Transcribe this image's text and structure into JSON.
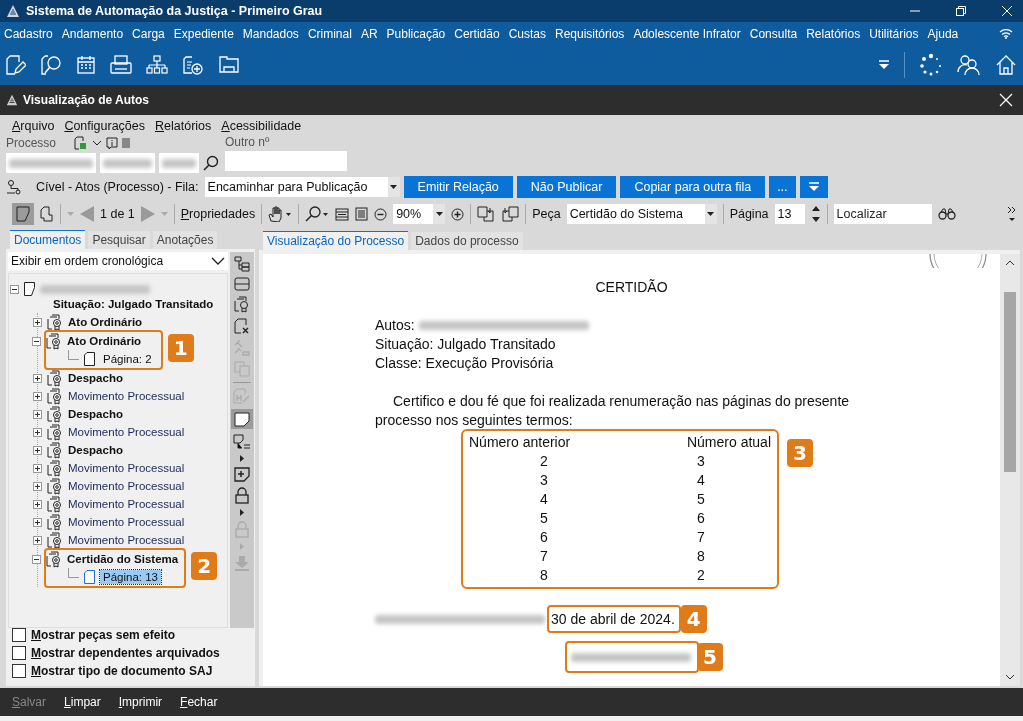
{
  "app_title": "Sistema de Automação da Justiça - Primeiro Grau",
  "main_menu": [
    "Cadastro",
    "Andamento",
    "Carga",
    "Expediente",
    "Mandados",
    "Criminal",
    "AR",
    "Publicação",
    "Certidão",
    "Custas",
    "Requisitórios",
    "Adolescente Infrator",
    "Consulta",
    "Relatórios",
    "Utilitários",
    "Ajuda"
  ],
  "window": {
    "title": "Visualização de Autos"
  },
  "menu": [
    "Arquivo",
    "Configurações",
    "Relatórios",
    "Acessibilidade"
  ],
  "process": {
    "label": "Processo",
    "other_label": "Outro nº"
  },
  "queue": {
    "label": "Cível - Atos (Processo) - Fila:",
    "value": "Encaminhar para Publicação"
  },
  "actions": [
    "Emitir Relação",
    "Não Publicar",
    "Copiar para outra fila",
    "..."
  ],
  "toolbar": {
    "pager": "1 de 1",
    "properties": "Propriedades",
    "zoom": "90%",
    "piece_label": "Peça",
    "piece": "Certidão do Sistema",
    "page_label": "Página",
    "page": "13",
    "search_placeholder": "Localizar"
  },
  "left_tabs": [
    {
      "label": "Documentos",
      "selected": true
    },
    {
      "label": "Pesquisar",
      "selected": false
    },
    {
      "label": "Anotações",
      "selected": false
    }
  ],
  "order": "Exibir em ordem cronológica",
  "tree": {
    "status": "Situação: Julgado Transitado",
    "expanded": true,
    "children": [
      {
        "label": "Ato Ordinário",
        "bold": true,
        "expanded": false
      },
      {
        "label": "Ato Ordinário",
        "bold": true,
        "expanded": true,
        "callout": "1",
        "children": [
          {
            "label": "Página: 2",
            "selected": false
          }
        ]
      },
      {
        "label": "Despacho",
        "bold": true,
        "expanded": false
      },
      {
        "label": "Movimento Processual",
        "bold": false,
        "expanded": false
      },
      {
        "label": "Despacho",
        "bold": true,
        "expanded": false
      },
      {
        "label": "Movimento Processual",
        "bold": false,
        "expanded": false
      },
      {
        "label": "Despacho",
        "bold": true,
        "expanded": false
      },
      {
        "label": "Movimento Processual",
        "bold": false,
        "expanded": false
      },
      {
        "label": "Movimento Processual",
        "bold": false,
        "expanded": false
      },
      {
        "label": "Movimento Processual",
        "bold": false,
        "expanded": false
      },
      {
        "label": "Movimento Processual",
        "bold": false,
        "expanded": false
      },
      {
        "label": "Movimento Processual",
        "bold": false,
        "expanded": false
      },
      {
        "label": "Certidão do Sistema",
        "bold": true,
        "expanded": true,
        "callout": "2",
        "children": [
          {
            "label": "Página: 13",
            "selected": true
          }
        ]
      }
    ]
  },
  "options": [
    {
      "label": "Mostrar peças sem efeito",
      "checked": false
    },
    {
      "label": "Mostrar dependentes arquivados",
      "checked": false
    },
    {
      "label": "Mostrar tipo de documento SAJ",
      "checked": false
    }
  ],
  "footer": [
    {
      "label": "Salvar",
      "disabled": true
    },
    {
      "label": "Limpar",
      "disabled": false
    },
    {
      "label": "Imprimir",
      "disabled": false
    },
    {
      "label": "Fechar",
      "disabled": false
    }
  ],
  "doc_tabs": [
    {
      "label": "Visualização do Processo",
      "selected": true
    },
    {
      "label": "Dados do processo",
      "selected": false
    }
  ],
  "document": {
    "title": "CERTIDÃO",
    "autos_label": "Autos:",
    "status": "Situação: Julgado Transitado",
    "class": "Classe: Execução Provisória",
    "paragraph": "Certifico e dou fé que foi realizada renumeração nas páginas do presente processo nos seguintes termos:",
    "table": {
      "callout": "3",
      "columns": [
        "Número anterior",
        "Número atual"
      ],
      "rows": [
        [
          "2",
          "3"
        ],
        [
          "3",
          "4"
        ],
        [
          "4",
          "5"
        ],
        [
          "5",
          "6"
        ],
        [
          "6",
          "7"
        ],
        [
          "7",
          "8"
        ],
        [
          "8",
          "2"
        ]
      ]
    },
    "date": "30 de abril de 2024.",
    "date_callout": "4",
    "signature_callout": "5"
  }
}
